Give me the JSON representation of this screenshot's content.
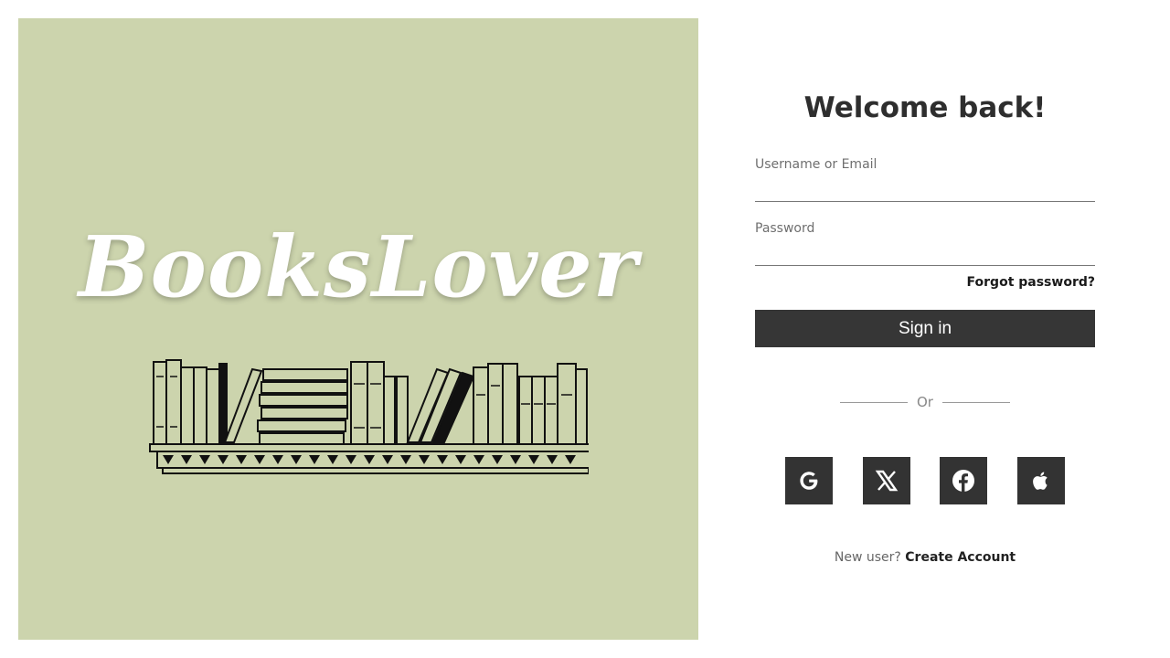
{
  "hero": {
    "brand": "BooksLover",
    "background_color": "#ccd4ad",
    "illustration": "bookshelf-illustration"
  },
  "login": {
    "title": "Welcome back!",
    "username_label": "Username or Email",
    "username_value": "",
    "password_label": "Password",
    "password_value": "",
    "forgot_label": "Forgot password?",
    "signin_label": "Sign in",
    "divider_text": "Or",
    "social": [
      {
        "icon": "google-icon"
      },
      {
        "icon": "x-icon"
      },
      {
        "icon": "facebook-icon"
      },
      {
        "icon": "apple-icon"
      }
    ],
    "signup_prompt": "New user?",
    "signup_link": "Create Account"
  },
  "colors": {
    "button": "#363636",
    "text": "#2e2e2e"
  }
}
